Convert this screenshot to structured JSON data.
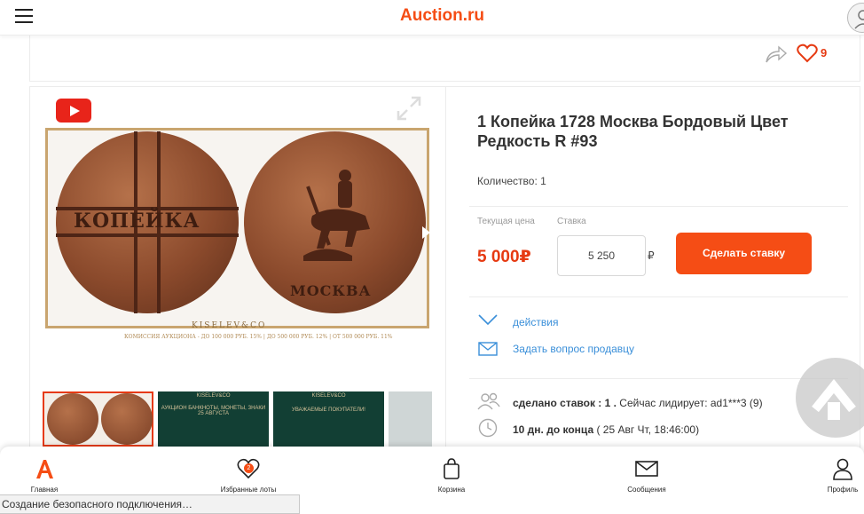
{
  "header": {
    "logo": "Auction.ru",
    "menu_icon": "hamburger-icon",
    "user_icon": "user-icon"
  },
  "lot": {
    "likes": "9",
    "title": "1 Копейка 1728 Москва Бордовый Цвет Редкость R #93",
    "quantity": "Количество: 1",
    "current_price_label": "Текущая цена",
    "bid_label": "Ставка",
    "price": "5 000₽",
    "bid_value": "5 250",
    "currency": "₽",
    "bid_button": "Сделать ставку",
    "actions_link": "действия",
    "ask_link": "Задать вопрос продавцу",
    "bids_count_bold": "сделано ставок : 1 .",
    "bids_rest": " Сейчас лидирует: ad1***3 (9)",
    "time_bold": "10 дн. до конца",
    "time_rest": " ( 25 Авг Чт, 18:46:00)"
  },
  "gallery": {
    "coin_obverse_text": "КОПЕЙКА",
    "coin_reverse_text": "МОСКВА",
    "brand": "KISELEV&CO",
    "brand_sub": "КОМИССИЯ АУКЦИОНА - ДО 100 000 РУБ. 15% | ДО 500 000 РУБ. 12% | ОТ 500 000 РУБ. 11%",
    "thumb2_text": "АУКЦИОН БАНКНОТЫ, МОНЕТЫ, ЗНАКИ 25 АВГУСТА",
    "thumb3_text": "УВАЖАЕМЫЕ ПОКУПАТЕЛИ!"
  },
  "bottom_nav": [
    {
      "label": "Главная",
      "icon": "home-logo-icon"
    },
    {
      "label": "Избранные лоты",
      "icon": "heart-icon",
      "badge": "2"
    },
    {
      "label": "Корзина",
      "icon": "bag-icon"
    },
    {
      "label": "Сообщения",
      "icon": "mail-icon"
    },
    {
      "label": "Профиль",
      "icon": "user-icon"
    }
  ],
  "status_bar": "Создание безопасного подключения…",
  "colors": {
    "accent": "#f54d15",
    "link": "#3a8fd9",
    "price": "#e63a12"
  }
}
